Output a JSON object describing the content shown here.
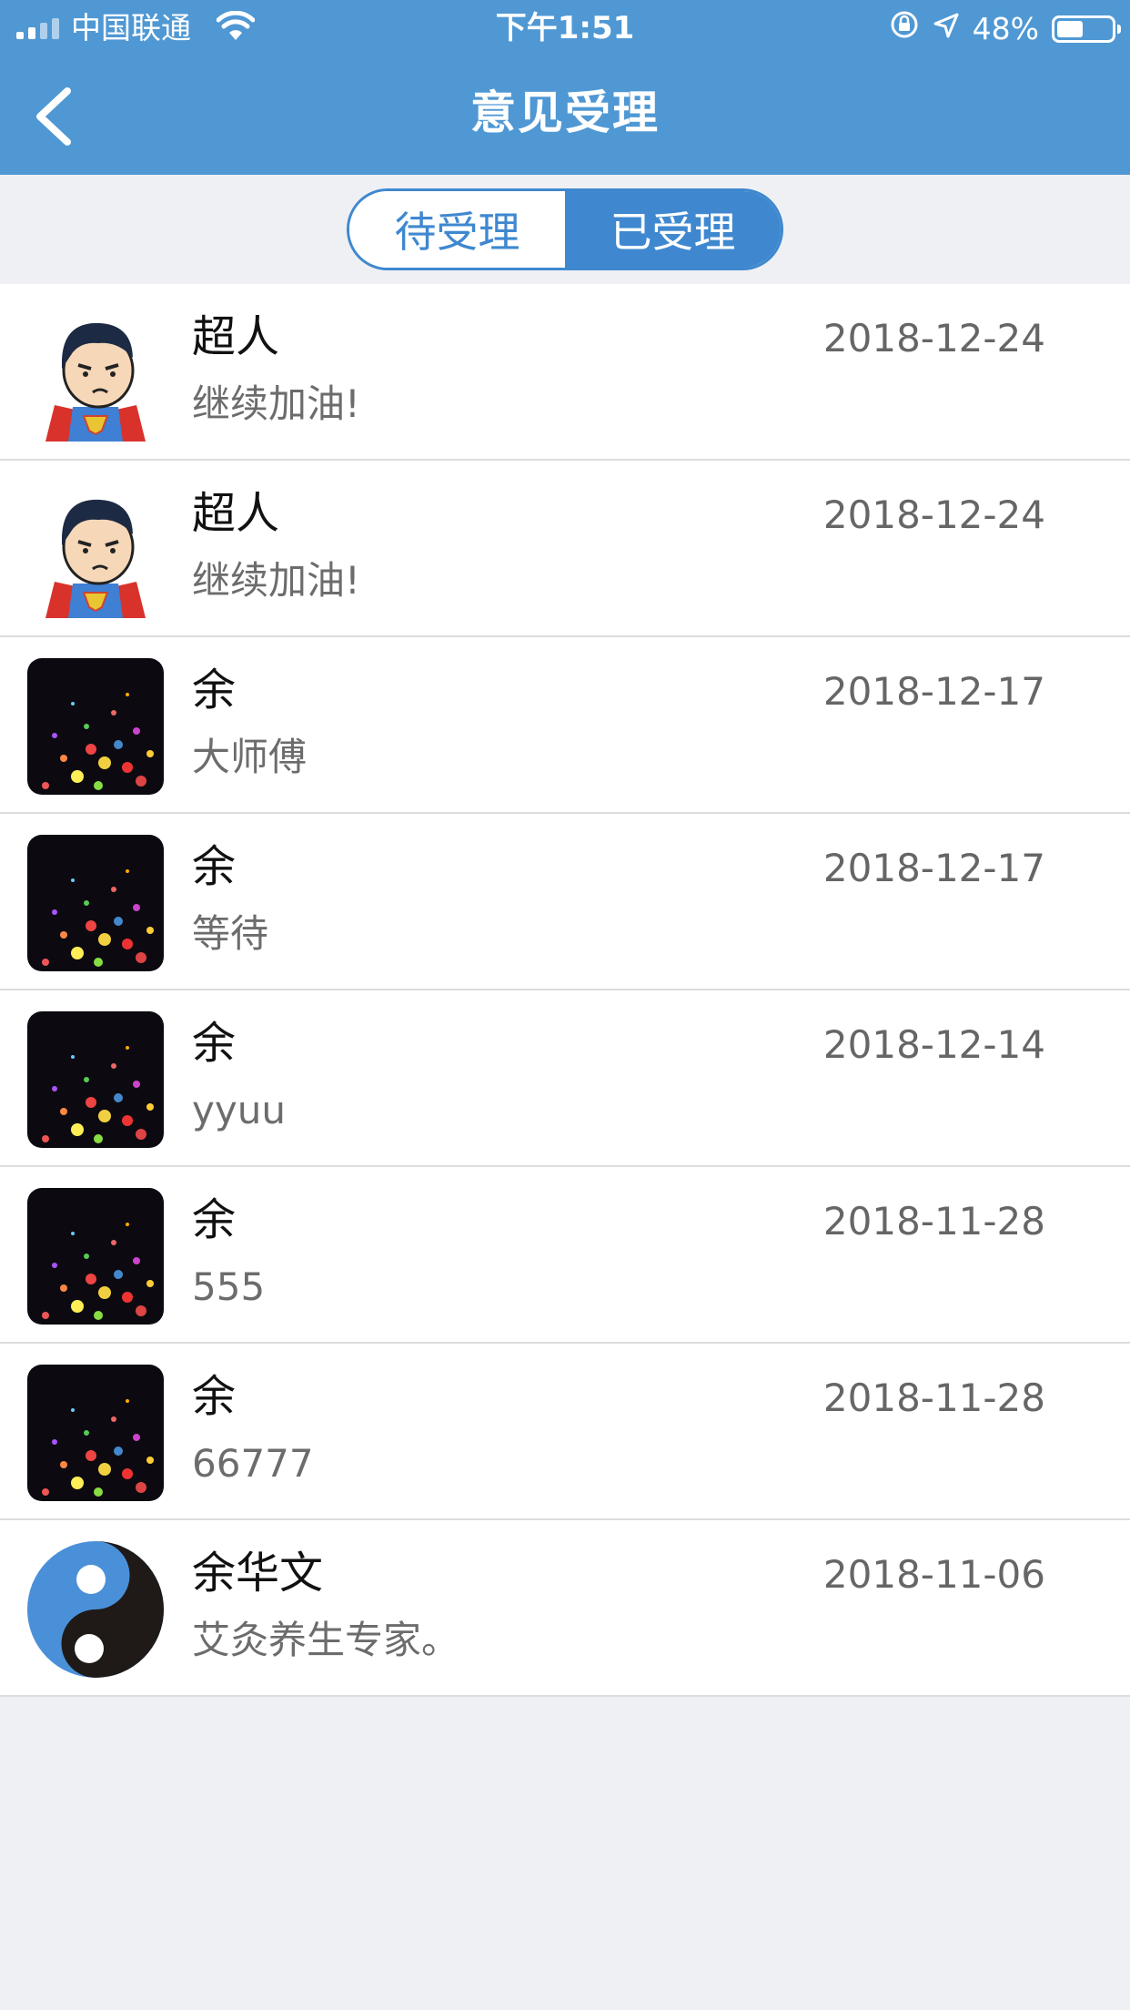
{
  "status_bar": {
    "carrier": "中国联通",
    "time": "下午1:51",
    "battery_percent": "48%",
    "battery_level": 0.48,
    "icons": [
      "signal-icon",
      "wifi-icon",
      "rotation-lock-icon",
      "location-arrow-icon",
      "battery-icon"
    ]
  },
  "header": {
    "title": "意见受理",
    "back_icon": "chevron-left-icon",
    "background_color": "#4f98d4"
  },
  "tabs": [
    {
      "label": "待受理",
      "active": false
    },
    {
      "label": "已受理",
      "active": true
    }
  ],
  "accent_color": "#3f88d0",
  "items": [
    {
      "name": "超人",
      "message": "继续加油!",
      "date": "2018-12-24",
      "avatar": "superman-avatar"
    },
    {
      "name": "超人",
      "message": "继续加油!",
      "date": "2018-12-24",
      "avatar": "superman-avatar"
    },
    {
      "name": "余",
      "message": "大师傅",
      "date": "2018-12-17",
      "avatar": "colorful-dots-avatar"
    },
    {
      "name": "余",
      "message": "等待",
      "date": "2018-12-17",
      "avatar": "colorful-dots-avatar"
    },
    {
      "name": "余",
      "message": "yyuu",
      "date": "2018-12-14",
      "avatar": "colorful-dots-avatar"
    },
    {
      "name": "余",
      "message": "555",
      "date": "2018-11-28",
      "avatar": "colorful-dots-avatar"
    },
    {
      "name": "余",
      "message": "66777",
      "date": "2018-11-28",
      "avatar": "colorful-dots-avatar"
    },
    {
      "name": "余华文",
      "message": "艾灸养生专家。",
      "date": "2018-11-06",
      "avatar": "yin-yang-avatar"
    }
  ]
}
